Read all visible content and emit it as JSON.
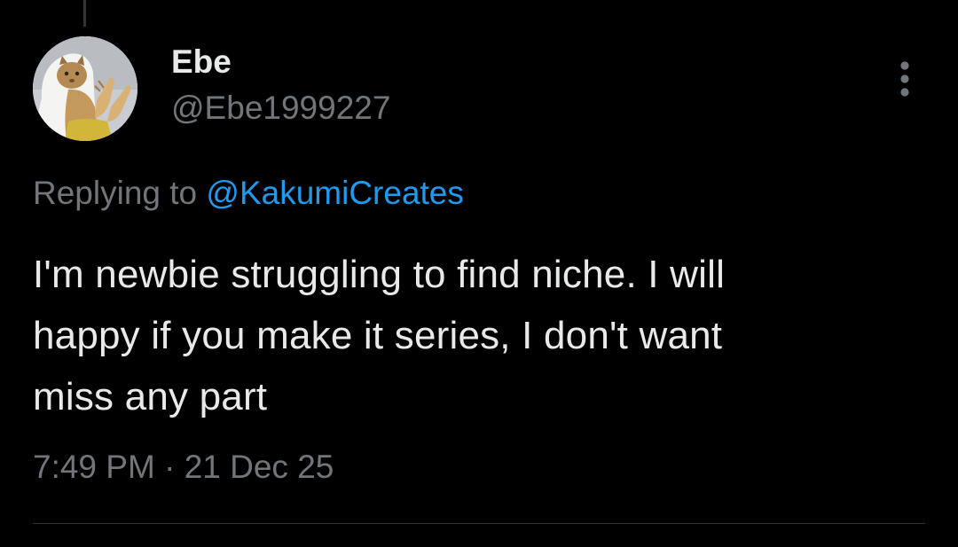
{
  "author": {
    "display_name": "Ebe",
    "handle": "@Ebe1999227",
    "avatar_icon": "praying-cat-avatar"
  },
  "reply": {
    "prefix": "Replying to ",
    "mention": "@KakumiCreates"
  },
  "tweet": {
    "text_lines": [
      "I'm newbie struggling to find niche. I will",
      "happy if you make it series, I don't want",
      "miss any part"
    ],
    "time": "7:49 PM",
    "separator": " · ",
    "date": "21 Dec 25"
  },
  "colors": {
    "background": "#000000",
    "primary_text": "#e7e9ea",
    "secondary_text": "#71767b",
    "link": "#1d9bf0",
    "divider": "#2f3336"
  },
  "icons": {
    "more": "more-vertical-icon"
  }
}
